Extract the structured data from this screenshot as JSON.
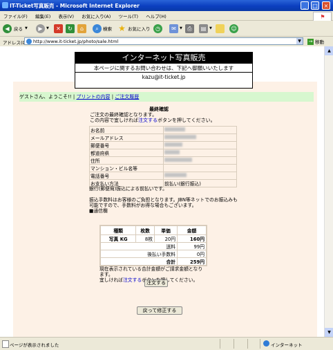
{
  "window": {
    "title": "IT-Ticket写真販売 - Microsoft Internet Explorer",
    "min": "_",
    "max": "□",
    "close": "×"
  },
  "menu": {
    "items": [
      "ファイル(F)",
      "編集(E)",
      "表示(V)",
      "お気に入り(A)",
      "ツール(T)",
      "ヘルプ(H)"
    ]
  },
  "toolbar": {
    "back": "戻る",
    "search": "検索",
    "favorites": "お気に入り"
  },
  "address": {
    "label": "アドレス(D)",
    "url": "http://www.it-ticket.jp/photo/sale.html",
    "go": "移動"
  },
  "site": {
    "title": "インターネット写真販売",
    "contact_line": "本ページに関するお問い合わせは、下記へ御願いいたします",
    "email": "kazu@it-ticket.jp"
  },
  "nav": {
    "greeting": "ゲストさん、ようこそ!!",
    "sep": "|",
    "link1": "プリントの内容",
    "link2": "ご注文履歴"
  },
  "confirm": {
    "title": "最終確認",
    "intro1": "ご注文の最終確認となります。",
    "intro2_a": "この内容で宜しければ",
    "intro2_link": "注文する",
    "intro2_b": "ボタンを押してください。",
    "fields": [
      {
        "label": "お名前",
        "value": ""
      },
      {
        "label": "メールアドレス",
        "value": ""
      },
      {
        "label": "郵便番号",
        "value": ""
      },
      {
        "label": "都道府県",
        "value": ""
      },
      {
        "label": "住所",
        "value": ""
      },
      {
        "label": "マンション・ビル名等",
        "value": ""
      },
      {
        "label": "電話番号",
        "value": ""
      },
      {
        "label": "お支払い方法",
        "value": "前払い(銀行振込)"
      }
    ],
    "note1": "銀行(郵便局)振込による前払いです。",
    "note2": "振込手数料はお客様のご負担となります。JBN等ネットでのお振込みも可能ですので、手数料がお得な場合もございます。",
    "note3": "■通信欄"
  },
  "order": {
    "headers": [
      "種類",
      "枚数",
      "単価",
      "金額"
    ],
    "row": {
      "type": "写真 KG",
      "qty": "8枚",
      "unit": "20円",
      "amount": "160円"
    },
    "shipping_label": "送料",
    "shipping": "99円",
    "fee_label": "後払い手数料",
    "fee": "0円",
    "total_label": "合計",
    "total": "259円"
  },
  "summary": {
    "msg1": "現在表示されている合計金額がご請求金額となります。",
    "msg2_a": "宜しければ",
    "msg2_link": "注文する",
    "msg2_b": "ボタンを押してください。",
    "order_button": "注文する",
    "back_button": "戻って修正する"
  },
  "status": {
    "text": "ページが表示されました",
    "zone": "インターネット"
  }
}
